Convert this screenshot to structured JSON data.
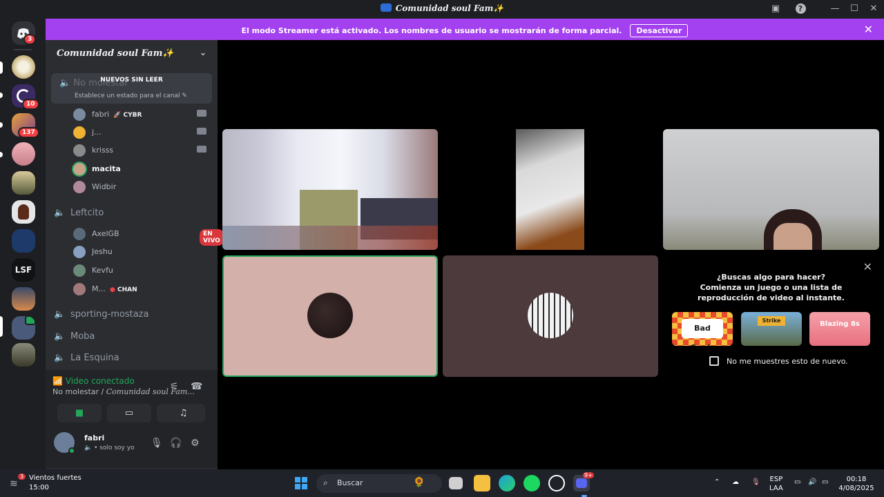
{
  "window": {
    "title": "Comunidad soul Fam✨"
  },
  "banner": {
    "message": "El modo Streamer está activado. Los nombres de usuario se mostrarán de forma parcial.",
    "button": "Desactivar"
  },
  "rail": {
    "home_badge": "3",
    "badges": [
      "10",
      "137"
    ],
    "lsf_label": "LSF"
  },
  "sidebar": {
    "guild_name": "Comunidad soul Fam✨",
    "unread_label": "NUEVOS SIN LEER",
    "faded_channel": "No molestar",
    "status_prompt": "Establece un estado para el canal",
    "channel_users": [
      {
        "name": "fabri",
        "tag": "🚀 CYBR"
      },
      {
        "name": "j...",
        "tag": ""
      },
      {
        "name": "krisss",
        "tag": ""
      },
      {
        "name": "macita",
        "tag": ""
      },
      {
        "name": "Widbir",
        "tag": ""
      }
    ],
    "channels": [
      {
        "name": "Leftcito"
      },
      {
        "name": "sporting-mostaza"
      },
      {
        "name": "Moba"
      },
      {
        "name": "La Esquina"
      }
    ],
    "leftcito_users": [
      {
        "name": "AxelGB",
        "tag": ""
      },
      {
        "name": "Jeshu",
        "tag": ""
      },
      {
        "name": "Kevfu",
        "tag": ""
      },
      {
        "name": "M...",
        "tag": "CHAN"
      }
    ],
    "live_label": "EN VIVO"
  },
  "voice": {
    "status": "Video conectado",
    "location": "No molestar / ",
    "location_guild": "Comunidad soul Fam..."
  },
  "user": {
    "name": "fabri",
    "status": "• solo soy yo"
  },
  "promo": {
    "heading": "¿Buscas algo para hacer?",
    "subtext": "Comienza un juego o una lista de reproducción de video al instante.",
    "games": [
      "Bad Cards",
      "Strike",
      "Blazing 8s"
    ],
    "checkbox_label": "No me muestres esto de nuevo."
  },
  "taskbar": {
    "weather": "Vientos fuertes",
    "weather_time": "15:00",
    "weather_badge": "3",
    "search_placeholder": "Buscar",
    "lang": "ESP",
    "lang_sub": "LAA",
    "time": "00:18",
    "date": "4/08/2025",
    "discord_badge": "9+"
  },
  "colors": {
    "accent": "#a340f0",
    "online": "#23a55a",
    "live": "#da373c",
    "sidebar": "#2b2d31"
  }
}
